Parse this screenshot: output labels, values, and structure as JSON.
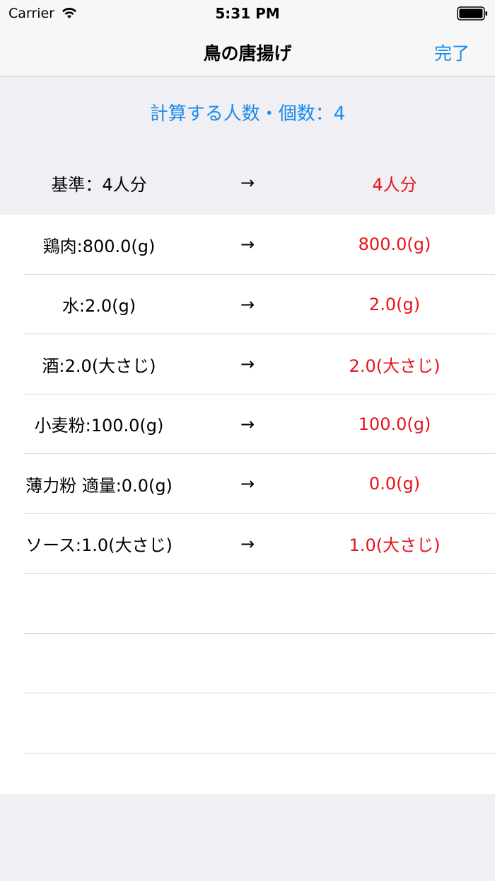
{
  "status_bar": {
    "carrier": "Carrier",
    "time": "5:31 PM"
  },
  "nav": {
    "title": "鳥の唐揚げ",
    "done_label": "完了"
  },
  "count": {
    "label": "計算する人数・個数：4"
  },
  "base": {
    "left": "基準：4人分",
    "arrow": "→",
    "right": "4人分"
  },
  "ingredients": [
    {
      "original": "鶏肉:800.0(g)",
      "arrow": "→",
      "converted": "800.0(g)"
    },
    {
      "original": "水:2.0(g)",
      "arrow": "→",
      "converted": "2.0(g)"
    },
    {
      "original": "酒:2.0(大さじ)",
      "arrow": "→",
      "converted": "2.0(大さじ)"
    },
    {
      "original": "小麦粉:100.0(g)",
      "arrow": "→",
      "converted": "100.0(g)"
    },
    {
      "original": "薄力粉 適量:0.0(g)",
      "arrow": "→",
      "converted": "0.0(g)"
    },
    {
      "original": "ソース:1.0(大さじ)",
      "arrow": "→",
      "converted": "1.0(大さじ)"
    }
  ],
  "colors": {
    "accent": "#1a8bea",
    "converted": "#e8131b",
    "background": "#efeff4"
  }
}
